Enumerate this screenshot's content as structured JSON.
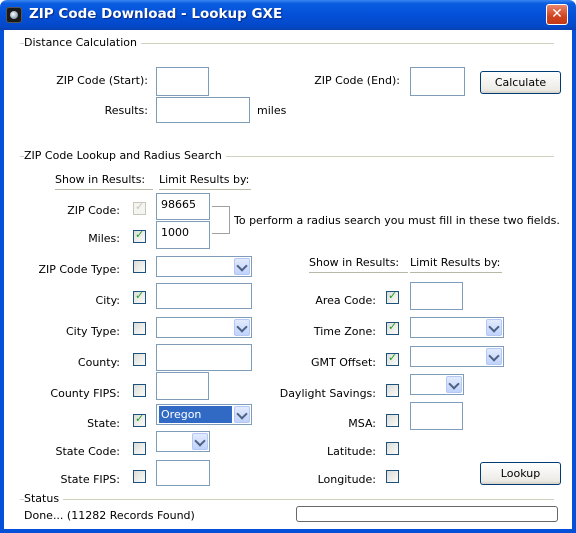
{
  "window": {
    "title": "ZIP Code Download - Lookup GXE",
    "close_glyph": "✕"
  },
  "distance": {
    "section_label": "Distance Calculation",
    "start_label": "ZIP Code (Start):",
    "start_value": "",
    "end_label": "ZIP Code (End):",
    "end_value": "",
    "calculate_label": "Calculate",
    "results_label": "Results:",
    "results_value": "",
    "miles_unit": "miles"
  },
  "lookup": {
    "section_label": "ZIP Code Lookup and Radius Search",
    "show_header": "Show in Results:",
    "limit_header": "Limit Results by:",
    "radius_note": "To perform a radius search you must fill in these two fields.",
    "left_fields": [
      {
        "label": "ZIP Code:",
        "checked": true,
        "disabled": true,
        "control": "text",
        "value": "98665"
      },
      {
        "label": "Miles:",
        "checked": true,
        "control": "text",
        "value": "1000"
      },
      {
        "label": "ZIP Code Type:",
        "checked": false,
        "control": "combo",
        "value": ""
      },
      {
        "label": "City:",
        "checked": true,
        "control": "text",
        "value": ""
      },
      {
        "label": "City Type:",
        "checked": false,
        "control": "combo",
        "value": ""
      },
      {
        "label": "County:",
        "checked": false,
        "control": "text",
        "value": ""
      },
      {
        "label": "County FIPS:",
        "checked": false,
        "control": "text",
        "value": ""
      },
      {
        "label": "State:",
        "checked": true,
        "control": "combo",
        "value": "Oregon"
      },
      {
        "label": "State Code:",
        "checked": false,
        "control": "combo",
        "value": ""
      },
      {
        "label": "State FIPS:",
        "checked": false,
        "control": "text",
        "value": ""
      }
    ],
    "right_fields": [
      {
        "label": "Area Code:",
        "checked": true,
        "control": "text",
        "value": ""
      },
      {
        "label": "Time Zone:",
        "checked": true,
        "control": "combo",
        "value": ""
      },
      {
        "label": "GMT Offset:",
        "checked": true,
        "control": "combo",
        "value": ""
      },
      {
        "label": "Daylight Savings:",
        "checked": false,
        "control": "combo",
        "value": ""
      },
      {
        "label": "MSA:",
        "checked": false,
        "control": "text",
        "value": ""
      },
      {
        "label": "Latitude:",
        "checked": false,
        "control": "none",
        "value": ""
      },
      {
        "label": "Longitude:",
        "checked": false,
        "control": "none",
        "value": ""
      }
    ],
    "lookup_label": "Lookup"
  },
  "status": {
    "section_label": "Status",
    "message": "Done... (11282 Records Found)",
    "progress": 0
  },
  "colors": {
    "titlebar": "#0450d8",
    "selection": "#316ac5",
    "check": "#21a121"
  }
}
